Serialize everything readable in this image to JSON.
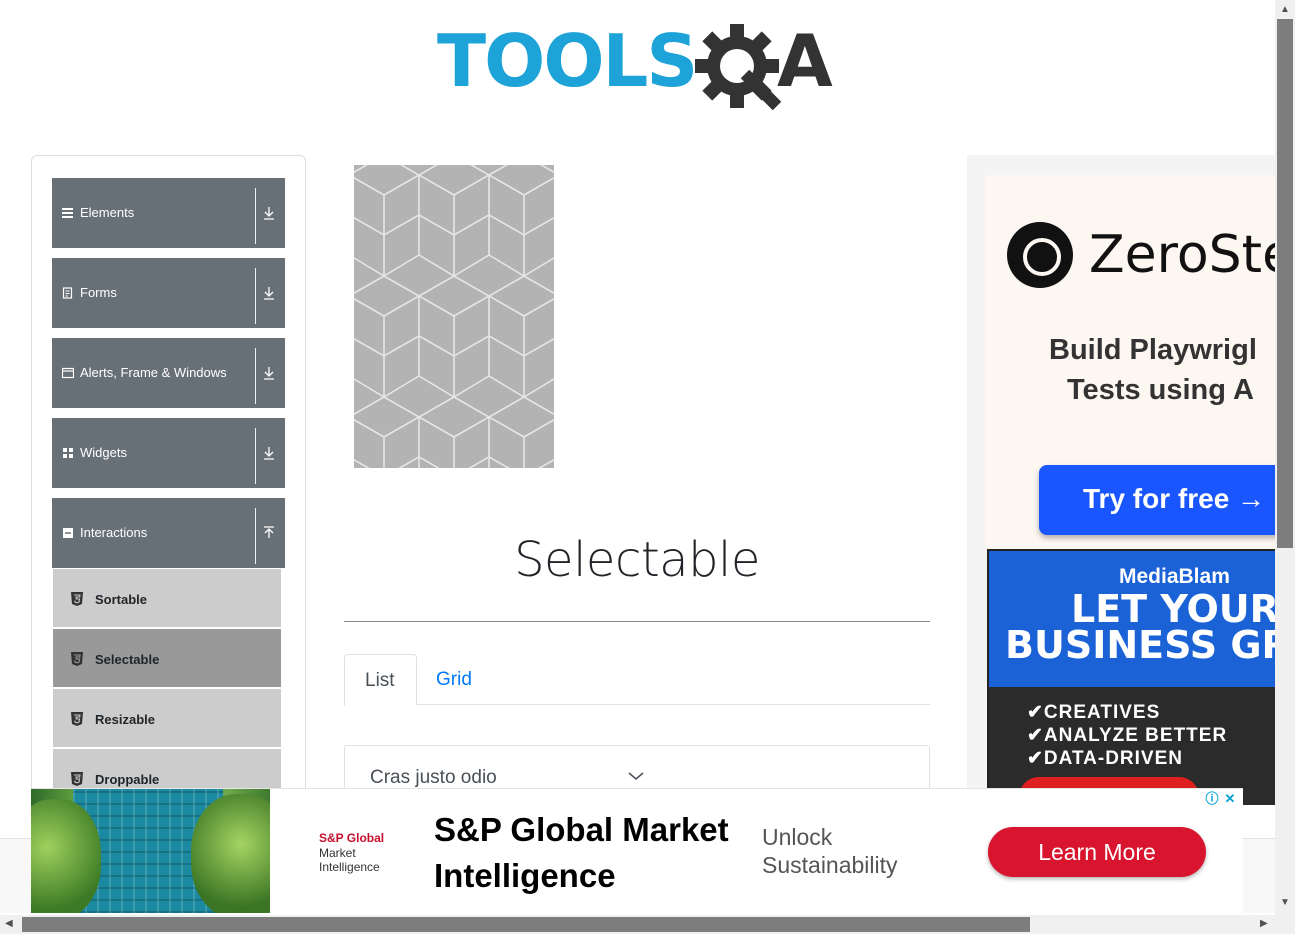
{
  "logo": {
    "text_left": "TOOLS",
    "text_right": "A"
  },
  "sidebar": {
    "groups": [
      {
        "label": "Elements",
        "icon": "hamburger-icon"
      },
      {
        "label": "Forms",
        "icon": "form-icon"
      },
      {
        "label": "Alerts, Frame & Windows",
        "icon": "window-icon"
      },
      {
        "label": "Widgets",
        "icon": "grid-icon"
      },
      {
        "label": "Interactions",
        "icon": "interactions-icon"
      }
    ],
    "interaction_items": [
      {
        "label": "Sortable",
        "active": false
      },
      {
        "label": "Selectable",
        "active": true
      },
      {
        "label": "Resizable",
        "active": false
      },
      {
        "label": "Droppable",
        "active": false
      }
    ]
  },
  "main": {
    "title": "Selectable",
    "tabs": [
      {
        "label": "List",
        "active": true
      },
      {
        "label": "Grid",
        "active": false
      }
    ],
    "list_items": [
      "Cras justo odio"
    ]
  },
  "ad_right": {
    "brand": "ZeroSte",
    "headline_1": "Build Playwrigl",
    "headline_2": "Tests using A",
    "cta": "Try for free →",
    "second_brand": "MediaBlam",
    "second_headline_1": "LET YOUR",
    "second_headline_2": "BUSINESS GR",
    "second_points": [
      "✔CREATIVES",
      "✔ANALYZE BETTER",
      "✔DATA-DRIVEN"
    ]
  },
  "ad_bottom": {
    "logo_line1": "S&P Global",
    "logo_line2": "Market",
    "logo_line3": "Intelligence",
    "headline_1": "S&P Global Market",
    "headline_2": "Intelligence",
    "sub_1": "Unlock",
    "sub_2": "Sustainability",
    "cta": "Learn More"
  },
  "colors": {
    "sidebar_group": "#687077",
    "sidebar_item": "#cccccc",
    "sidebar_active": "#999999",
    "logo_blue": "#1ea3d8",
    "logo_dark": "#333333",
    "link_blue": "#007bff"
  }
}
